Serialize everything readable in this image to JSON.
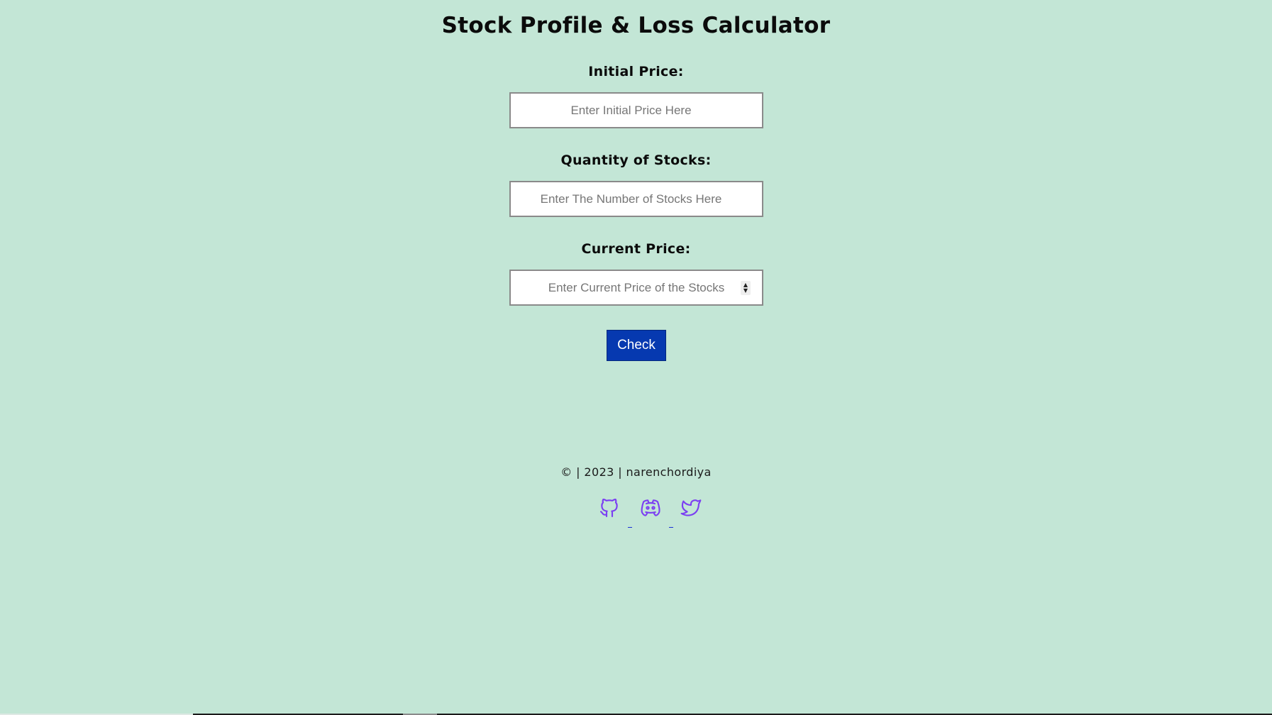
{
  "page": {
    "title": "Stock Profile & Loss Calculator",
    "background_color": "#c3e6d6"
  },
  "form": {
    "initial_price": {
      "label": "Initial Price:",
      "placeholder": "Enter Initial Price Here",
      "value": ""
    },
    "quantity": {
      "label": "Quantity of Stocks:",
      "placeholder": "Enter The Number of Stocks Here",
      "value": ""
    },
    "current_price": {
      "label": "Current Price:",
      "placeholder": "Enter Current Price of the Stocks",
      "value": ""
    },
    "check_button": {
      "label": "Check",
      "color": "#0639b0"
    }
  },
  "footer": {
    "text": "© | 2023 | narenchordiya",
    "icon_color": "#7b3ff2",
    "links": [
      {
        "icon": "github-icon"
      },
      {
        "icon": "discord-icon"
      },
      {
        "icon": "twitter-icon"
      }
    ]
  }
}
